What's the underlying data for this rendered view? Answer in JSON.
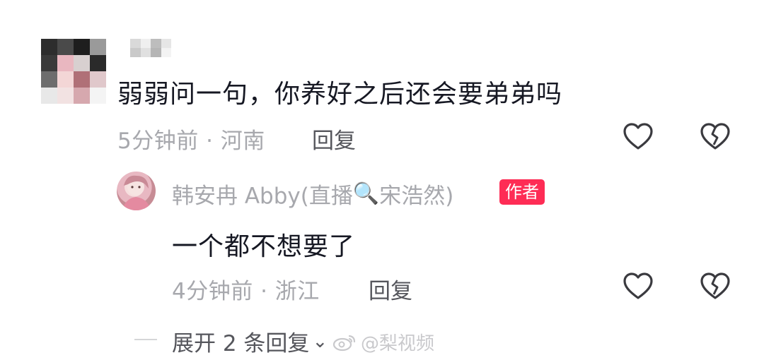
{
  "comment": {
    "text": "弱弱问一句，你养好之后还会要弟弟吗",
    "time_location": "5分钟前 · 河南",
    "reply_label": "回复",
    "like_icon": "heart-outline-icon",
    "dislike_icon": "broken-heart-icon"
  },
  "reply": {
    "username_prefix": "韩安冉 Abby(直播",
    "search_emoji": "🔍",
    "username_suffix": "宋浩然)",
    "badge": "作者",
    "text": "一个都不想要了",
    "time_location": "4分钟前 · 浙江",
    "reply_label": "回复"
  },
  "expand": {
    "label": "展开 2 条回复",
    "chevron": "⌄"
  },
  "watermark": "@梨视频",
  "colors": {
    "badge_bg": "#fe2c55",
    "meta_text": "#a7a8ad",
    "primary_text": "#161823"
  }
}
